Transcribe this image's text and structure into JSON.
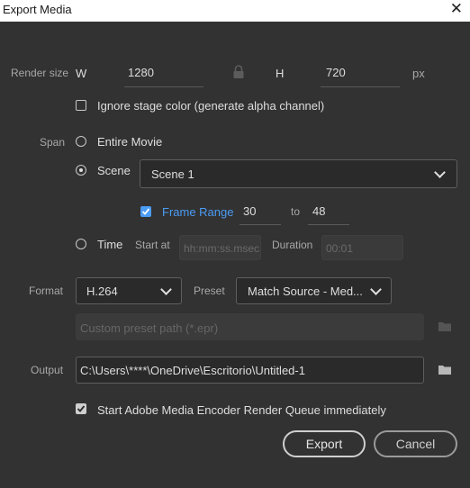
{
  "window": {
    "title": "Export Media"
  },
  "render_size": {
    "label": "Render size",
    "w_label": "W",
    "w_value": "1280",
    "h_label": "H",
    "h_value": "720",
    "unit": "px"
  },
  "ignore_stage": {
    "label": "Ignore stage color (generate alpha channel)",
    "checked": false
  },
  "span": {
    "label": "Span",
    "entire_movie": "Entire Movie",
    "scene_label": "Scene",
    "scene_value": "Scene 1",
    "frame_range_label": "Frame Range",
    "frame_from": "30",
    "to_label": "to",
    "frame_to": "48",
    "time_label": "Time",
    "start_at_label": "Start at",
    "start_at_placeholder": "hh:mm:ss.msec",
    "duration_label": "Duration",
    "duration_placeholder": "00:01"
  },
  "format": {
    "label": "Format",
    "value": "H.264",
    "preset_label": "Preset",
    "preset_value": "Match Source - Med..."
  },
  "custom_preset": {
    "placeholder": "Custom preset path (*.epr)"
  },
  "output": {
    "label": "Output",
    "value": "C:\\Users\\****\\OneDrive\\Escritorio\\Untitled-1"
  },
  "ame_queue": {
    "label": "Start Adobe Media Encoder Render Queue immediately",
    "checked": true
  },
  "buttons": {
    "export": "Export",
    "cancel": "Cancel"
  },
  "colors": {
    "background": "#323232",
    "accent": "#4b9cf5"
  },
  "icons": {
    "lock": "lock-icon",
    "folder": "folder-icon",
    "close": "close-icon"
  }
}
